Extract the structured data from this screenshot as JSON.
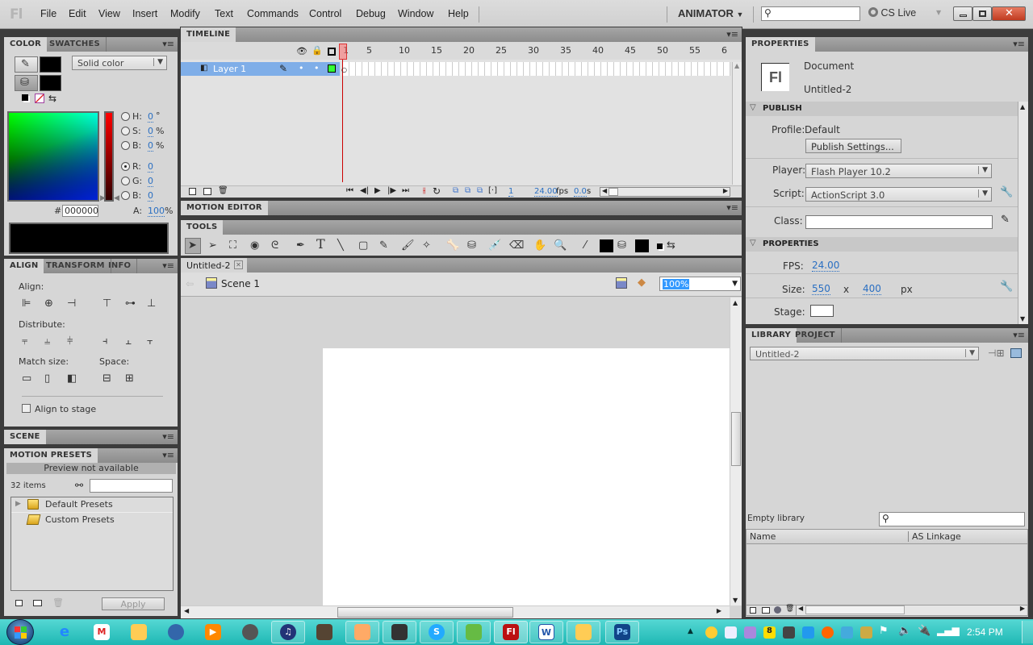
{
  "app": {
    "logo": "Fl",
    "menu": [
      "File",
      "Edit",
      "View",
      "Insert",
      "Modify",
      "Text",
      "Commands",
      "Control",
      "Debug",
      "Window",
      "Help"
    ],
    "workspace": "ANIMATOR",
    "search_placeholder": "",
    "cs_live": "CS Live"
  },
  "color_panel": {
    "tabs": [
      "COLOR",
      "SWATCHES"
    ],
    "fill_type": "Solid color",
    "stroke_color": "#000000",
    "fill_color": "#000000",
    "h_label": "H:",
    "h_value": "0",
    "h_unit": "°",
    "s_label": "S:",
    "s_value": "0",
    "s_unit": "%",
    "b_label": "B:",
    "b_value": "0",
    "b_unit": "%",
    "r_label": "R:",
    "r_value": "0",
    "g_label": "G:",
    "g_value": "0",
    "bl_label": "B:",
    "bl_value": "0",
    "a_label": "A:",
    "a_value": "100",
    "a_unit": "%",
    "hex_label": "#",
    "hex_value": "000000",
    "selected_channel": "R"
  },
  "align_panel": {
    "tabs": [
      "ALIGN",
      "TRANSFORM",
      "INFO"
    ],
    "align_label": "Align:",
    "distribute_label": "Distribute:",
    "match_size_label": "Match size:",
    "space_label": "Space:",
    "align_to_stage": "Align to stage",
    "align_to_stage_checked": false
  },
  "scene_panel": {
    "tab": "SCENE"
  },
  "motion_presets": {
    "tab": "MOTION PRESETS",
    "preview": "Preview not available",
    "count": "32 items",
    "items": [
      {
        "label": "Default Presets",
        "expandable": true
      },
      {
        "label": "Custom Presets",
        "expandable": false
      }
    ],
    "apply": "Apply"
  },
  "timeline": {
    "tab": "TIMELINE",
    "frame_numbers": [
      "1",
      "5",
      "10",
      "15",
      "20",
      "25",
      "30",
      "35",
      "40",
      "45",
      "50",
      "55",
      "6"
    ],
    "layer": "Layer 1",
    "current_frame": "1",
    "fps": "24.00",
    "fps_unit": "fps",
    "time": "0.0",
    "time_unit": "s"
  },
  "motion_editor": {
    "tab": "MOTION EDITOR"
  },
  "tools": {
    "tab": "TOOLS",
    "items": [
      "selection",
      "subselection",
      "free-transform",
      "3d-rotation",
      "lasso",
      "pen",
      "text",
      "line",
      "rectangle",
      "pencil",
      "brush",
      "deco",
      "bone",
      "paint-bucket",
      "eyedropper",
      "eraser",
      "hand",
      "zoom"
    ],
    "text_glyph": "T"
  },
  "document": {
    "tab": "Untitled-2",
    "scene": "Scene 1",
    "zoom": "100%"
  },
  "properties": {
    "tab": "PROPERTIES",
    "doc_icon": "Fl",
    "type": "Document",
    "name": "Untitled-2",
    "publish_header": "PUBLISH",
    "profile_label": "Profile:",
    "profile_value": "Default",
    "publish_settings": "Publish Settings...",
    "player_label": "Player:",
    "player_value": "Flash Player 10.2",
    "script_label": "Script:",
    "script_value": "ActionScript 3.0",
    "class_label": "Class:",
    "class_value": "",
    "properties_header": "PROPERTIES",
    "fps_label": "FPS:",
    "fps_value": "24.00",
    "size_label": "Size:",
    "width": "550",
    "x": "x",
    "height": "400",
    "px": "px",
    "stage_label": "Stage:",
    "stage_color": "#ffffff"
  },
  "library": {
    "tabs": [
      "LIBRARY",
      "PROJECT"
    ],
    "document": "Untitled-2",
    "status": "Empty library",
    "columns": [
      "Name",
      "AS Linkage"
    ]
  },
  "taskbar": {
    "clock": "2:54 PM",
    "pinned": [
      "internet-explorer",
      "gmail",
      "windows-explorer-2",
      "network",
      "media-player",
      "app",
      "itunes",
      "app2",
      "paint",
      "terminal",
      "skype",
      "messenger",
      "flash",
      "word",
      "file-explorer",
      "photoshop"
    ]
  }
}
